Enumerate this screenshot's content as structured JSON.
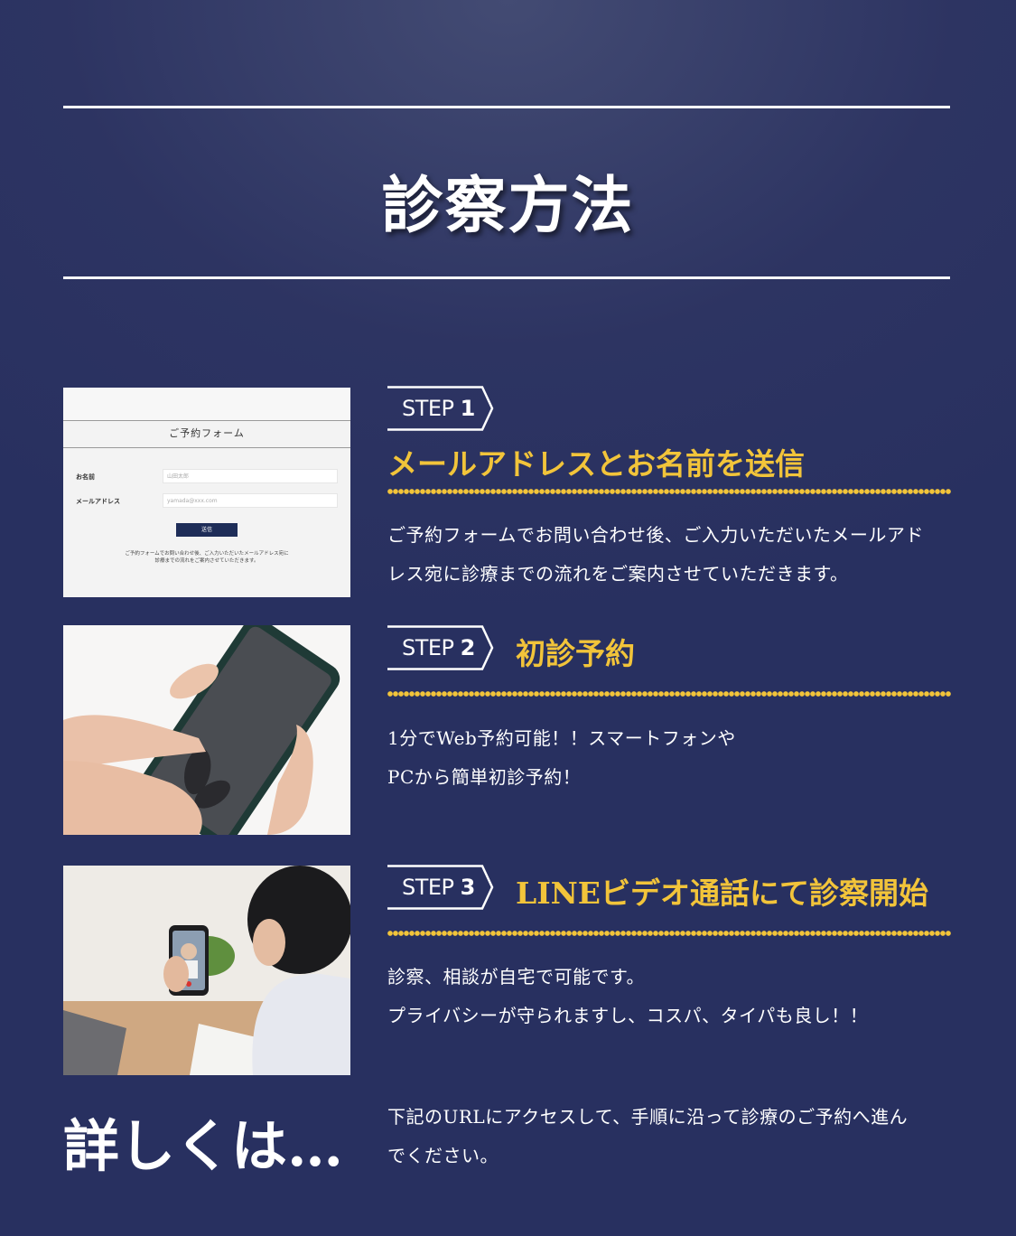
{
  "section": {
    "title": "診察方法"
  },
  "steps": [
    {
      "badge_word": "STEP",
      "badge_num": "1",
      "title": "メールアドレスとお名前を送信",
      "desc_line1": "ご予約フォームでお問い合わせ後、ご入力いただいたメールアド",
      "desc_line2": "レス宛に診療までの流れをご案内させていただきます。",
      "form": {
        "title": "ご予約フォーム",
        "name_label": "お名前",
        "name_placeholder": "山田太郎",
        "email_label": "メールアドレス",
        "email_placeholder": "yamada@xxx.com",
        "submit_label": "送信",
        "note_line1": "ご予約フォームでお問い合わせ後、ご入力いただいたメールアドレス宛に",
        "note_line2": "診療までの流れをご案内させていただきます。"
      }
    },
    {
      "badge_word": "STEP",
      "badge_num": "2",
      "title": "初診予約",
      "desc_line1": "1分でWeb予約可能！！スマートフォンや",
      "desc_line2": "PCから簡単初診予約！"
    },
    {
      "badge_word": "STEP",
      "badge_num": "3",
      "title": "LINEビデオ通話にて診察開始",
      "desc_line1": "診察、相談が自宅で可能です。",
      "desc_line2": "プライバシーが守られますし、コスパ、タイパも良し！！"
    }
  ],
  "footer": {
    "heading": "詳しくは…",
    "desc_line1": "下記のURLにアクセスして、手順に沿って診療のご予約へ進ん",
    "desc_line2": "でください。"
  },
  "colors": {
    "background": "#2d3462",
    "accent": "#f2c43a",
    "text": "#ffffff"
  }
}
